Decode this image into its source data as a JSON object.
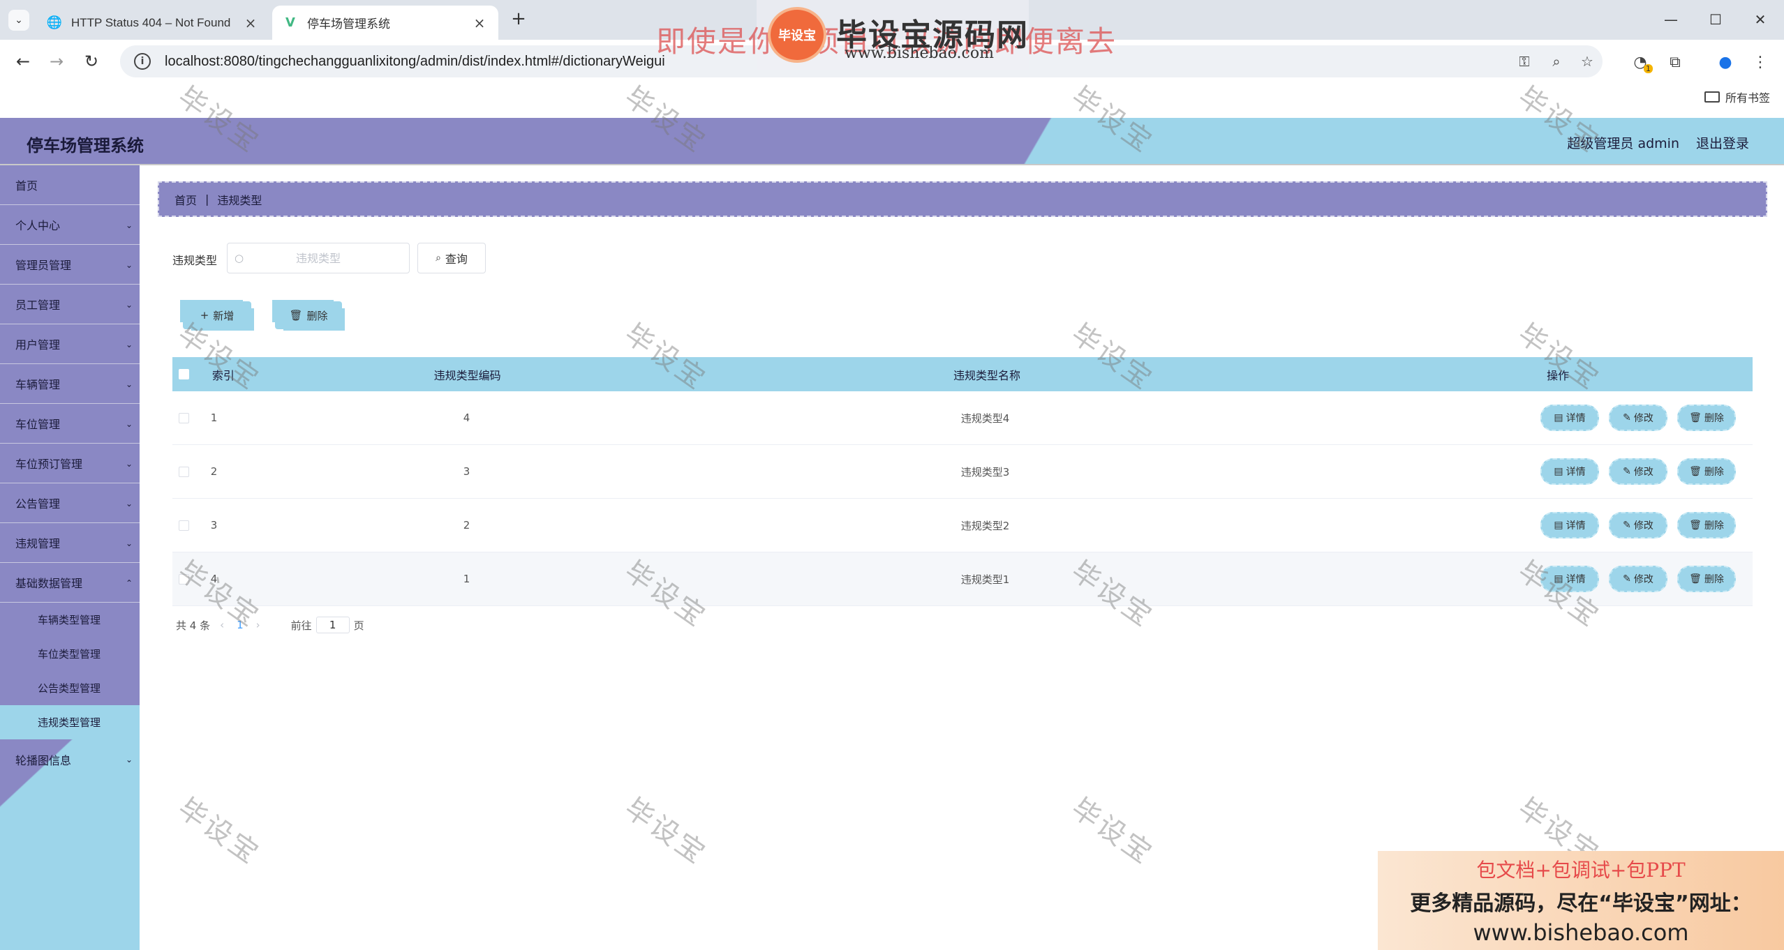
{
  "browser": {
    "tabs": [
      {
        "title": "HTTP Status 404 – Not Found",
        "active": false
      },
      {
        "title": "停车场管理系统",
        "active": true
      }
    ],
    "url": "localhost:8080/tingchechangguanlixitong/admin/dist/index.html#/dictionaryWeigui",
    "bookmarks_all": "所有书签",
    "extension_badge": "1"
  },
  "overlay": {
    "banner_text": "即使是你的项目可以访问即便离去",
    "logo_text": "毕设宝",
    "brand_name": "毕设宝源码网",
    "brand_url": "www.bishebao.com",
    "watermark": "毕设宝",
    "promo_line1": "包文档+包调试+包PPT",
    "promo_line2": "更多精品源码，尽在“毕设宝”网址：",
    "promo_line3": "www.bishebao.com"
  },
  "app": {
    "title": "停车场管理系统",
    "user": "超级管理员 admin",
    "logout": "退出登录"
  },
  "sidebar": {
    "items": [
      {
        "label": "首页",
        "has_arrow": false
      },
      {
        "label": "个人中心",
        "has_arrow": true
      },
      {
        "label": "管理员管理",
        "has_arrow": true
      },
      {
        "label": "员工管理",
        "has_arrow": true
      },
      {
        "label": "用户管理",
        "has_arrow": true
      },
      {
        "label": "车辆管理",
        "has_arrow": true
      },
      {
        "label": "车位管理",
        "has_arrow": true
      },
      {
        "label": "车位预订管理",
        "has_arrow": true
      },
      {
        "label": "公告管理",
        "has_arrow": true
      },
      {
        "label": "违规管理",
        "has_arrow": true
      },
      {
        "label": "基础数据管理",
        "has_arrow": true
      }
    ],
    "submenu": [
      {
        "label": "车辆类型管理",
        "active": false
      },
      {
        "label": "车位类型管理",
        "active": false
      },
      {
        "label": "公告类型管理",
        "active": false
      },
      {
        "label": "违规类型管理",
        "active": true
      }
    ],
    "last_item": "轮播图信息"
  },
  "breadcrumb": {
    "home": "首页",
    "current": "违规类型"
  },
  "search": {
    "label": "违规类型",
    "placeholder": "违规类型",
    "value": "",
    "button": "查询"
  },
  "actions": {
    "add": "新增",
    "delete": "删除"
  },
  "table": {
    "headers": {
      "index": "索引",
      "code": "违规类型编码",
      "name": "违规类型名称",
      "ops": "操作"
    },
    "rows": [
      {
        "index": "1",
        "code": "4",
        "name": "违规类型4"
      },
      {
        "index": "2",
        "code": "3",
        "name": "违规类型3"
      },
      {
        "index": "3",
        "code": "2",
        "name": "违规类型2"
      },
      {
        "index": "4",
        "code": "1",
        "name": "违规类型1"
      }
    ],
    "op_labels": {
      "detail": "详情",
      "edit": "修改",
      "delete": "删除"
    }
  },
  "pagination": {
    "total": "共 4 条",
    "current_page": "1",
    "goto_label": "前往",
    "goto_value": "1",
    "page_suffix": "页"
  },
  "colors": {
    "purple": "#8a88c4",
    "sky": "#9dd5ea",
    "link": "#409eff"
  }
}
